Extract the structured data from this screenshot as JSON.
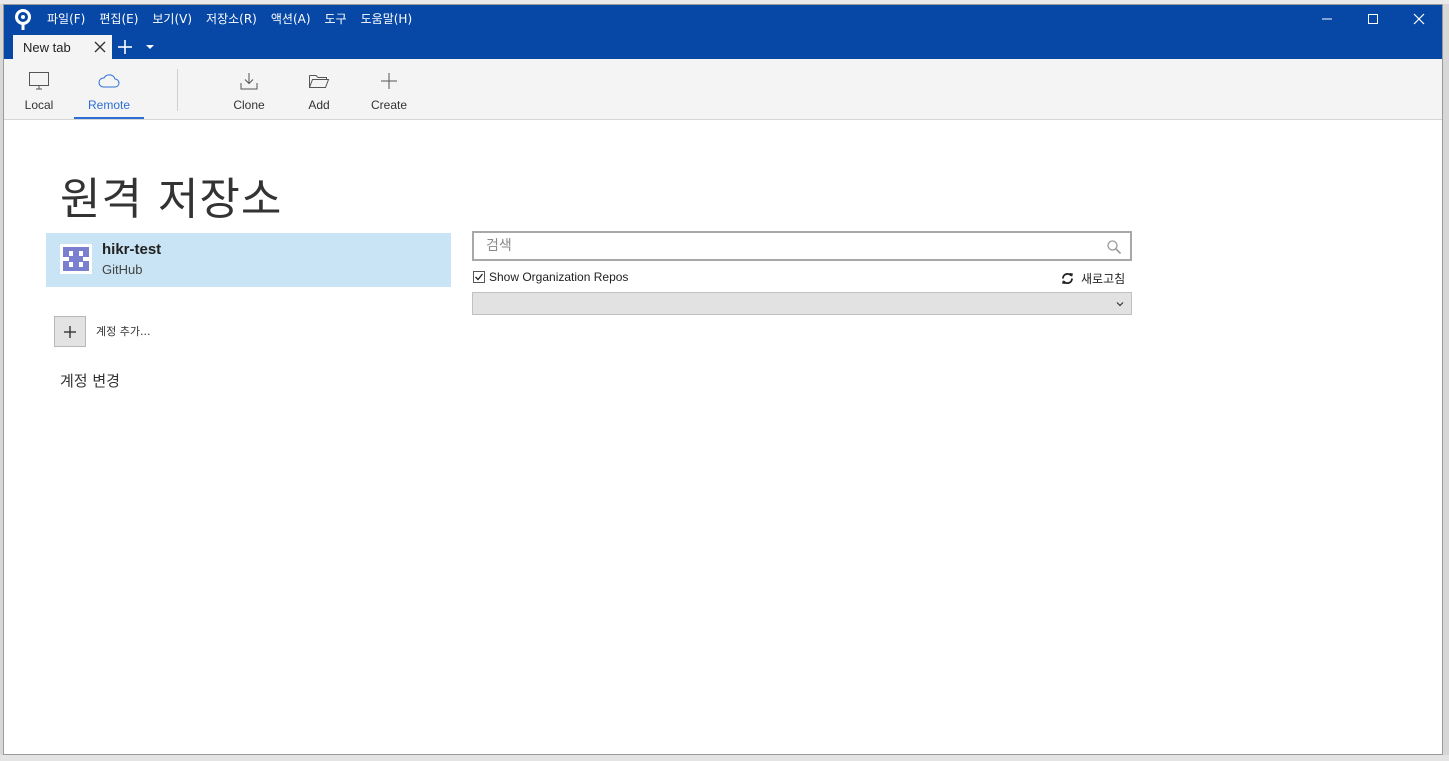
{
  "menu": {
    "items": [
      {
        "label": "파일(F)"
      },
      {
        "label": "편집(E)"
      },
      {
        "label": "보기(V)"
      },
      {
        "label": "저장소(R)"
      },
      {
        "label": "액션(A)"
      },
      {
        "label": "도구"
      },
      {
        "label": "도움말(H)"
      }
    ]
  },
  "tabs": {
    "active_label": "New tab"
  },
  "toolbar": {
    "local_label": "Local",
    "remote_label": "Remote",
    "clone_label": "Clone",
    "add_label": "Add",
    "create_label": "Create"
  },
  "main": {
    "title": "원격 저장소",
    "account": {
      "name": "hikr-test",
      "host": "GitHub"
    },
    "add_account_label": "계정 추가...",
    "change_account_label": "계정 변경",
    "search": {
      "placeholder": "검색",
      "value": ""
    },
    "show_org_repos": {
      "label": "Show Organization Repos",
      "checked": true
    },
    "refresh_label": "새로고침",
    "dropdown_value": ""
  },
  "colors": {
    "titlebar": "#0747a6",
    "accent": "#2b6fd6",
    "selected_account_bg": "#c9e4f5",
    "avatar": "#7b7fd0"
  }
}
